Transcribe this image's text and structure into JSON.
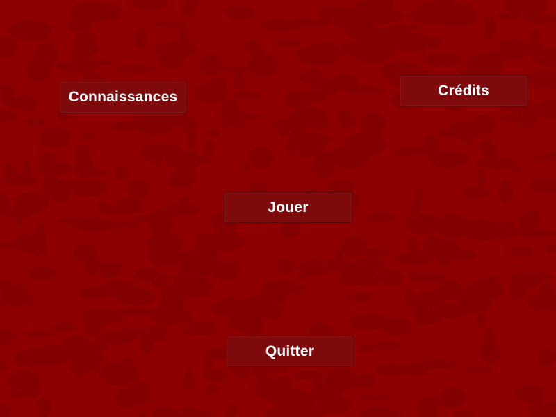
{
  "menu": {
    "knowledge_label": "Connaissances",
    "credits_label": "Crédits",
    "play_label": "Jouer",
    "quit_label": "Quitter"
  },
  "colors": {
    "background": "#8e0000",
    "pattern_dark": "#7a0000",
    "button_fill": "#7f0a0c",
    "button_text": "#ffffff"
  }
}
